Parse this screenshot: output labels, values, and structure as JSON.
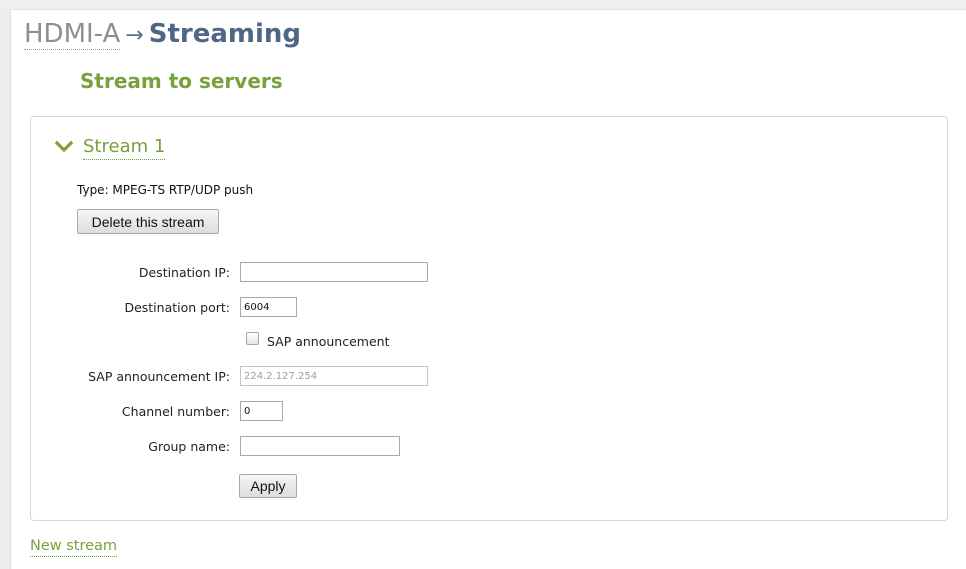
{
  "heading": {
    "source": "HDMI-A",
    "arrow": "→",
    "current": "Streaming"
  },
  "section_title": "Stream to servers",
  "stream": {
    "name": "Stream 1",
    "expanded": true,
    "icon": "chevron-down-icon",
    "type_text": "Type: MPEG-TS RTP/UDP push",
    "delete_label": "Delete this stream",
    "fields": {
      "destination_ip": {
        "label": "Destination IP:",
        "value": ""
      },
      "destination_port": {
        "label": "Destination port:",
        "value": "6004"
      },
      "sap_announcement": {
        "label": "SAP announcement",
        "checked": false
      },
      "sap_ip": {
        "label": "SAP announcement IP:",
        "value": "224.2.127.254",
        "disabled": true
      },
      "channel_number": {
        "label": "Channel number:",
        "value": "0"
      },
      "group_name": {
        "label": "Group name:",
        "value": ""
      }
    },
    "apply_label": "Apply"
  },
  "new_stream_label": "New stream",
  "colors": {
    "accent_green": "#78a13c",
    "heading_blue": "#4e6785",
    "muted_gray": "#8e8e8e"
  }
}
